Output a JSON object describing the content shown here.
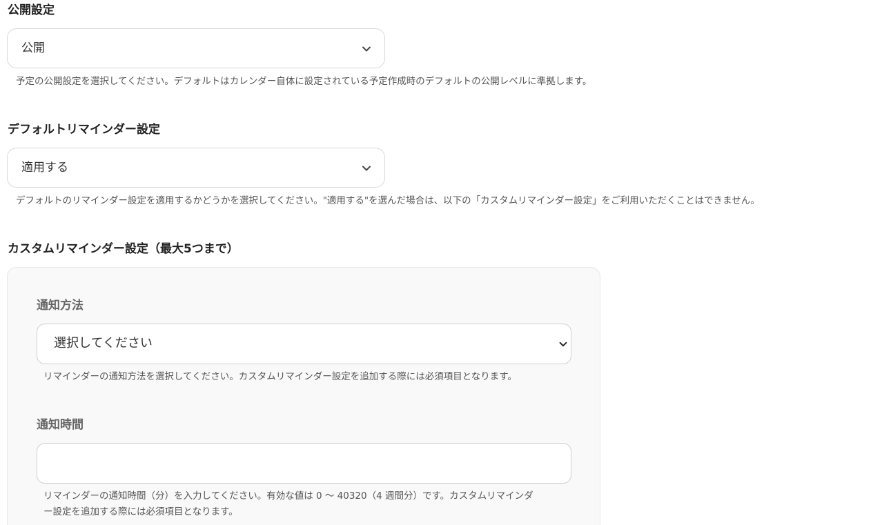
{
  "visibility": {
    "title": "公開設定",
    "selected": "公開",
    "help": "予定の公開設定を選択してください。デフォルトはカレンダー自体に設定されている予定作成時のデフォルトの公開レベルに準拠します。"
  },
  "default_reminder": {
    "title": "デフォルトリマインダー設定",
    "selected": "適用する",
    "help": "デフォルトのリマインダー設定を適用するかどうかを選択してください。\"適用する\"を選んだ場合は、以下の「カスタムリマインダー設定」をご利用いただくことはできません。"
  },
  "custom_reminder": {
    "title": "カスタムリマインダー設定（最大5つまで）",
    "method": {
      "label": "通知方法",
      "selected": "選択してください",
      "help": "リマインダーの通知方法を選択してください。カスタムリマインダー設定を追加する際には必須項目となります。"
    },
    "time": {
      "label": "通知時間",
      "value": "",
      "help_line1": "リマインダーの通知時間（分）を入力してください。有効な値は 0 〜 40320（4 週間分）です。カスタムリマインダ",
      "help_line2": "ー設定を追加する際には必須項目となります。"
    }
  },
  "icons": {
    "dropdown": "chevron-down-icon"
  },
  "colors": {
    "panel_background": "#f9f9f9",
    "border": "#d9d9d9",
    "help_text": "#555555"
  }
}
